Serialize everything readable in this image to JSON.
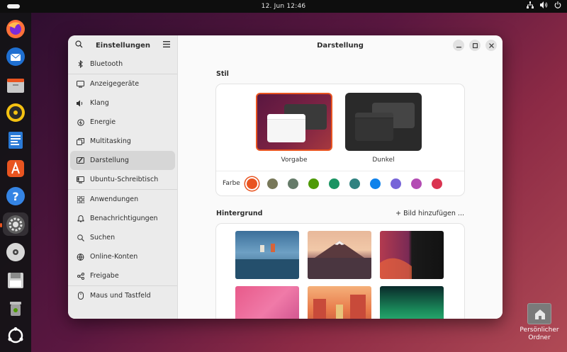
{
  "topbar": {
    "clock": "12. Jun  12:46"
  },
  "dock": {
    "items": [
      {
        "name": "firefox",
        "active": false
      },
      {
        "name": "thunderbird",
        "active": false
      },
      {
        "name": "files",
        "active": false
      },
      {
        "name": "rhythmbox",
        "active": false
      },
      {
        "name": "writer",
        "active": false
      },
      {
        "name": "app-center",
        "active": false
      },
      {
        "name": "help",
        "active": false
      },
      {
        "name": "settings",
        "active": true
      },
      {
        "name": "disc",
        "active": false
      },
      {
        "name": "save",
        "active": false
      },
      {
        "name": "trash",
        "active": false
      },
      {
        "name": "ubuntu-apps",
        "active": false
      }
    ]
  },
  "settings": {
    "title": "Einstellungen",
    "sidebar": {
      "items": [
        {
          "id": "bluetooth",
          "label": "Bluetooth",
          "icon": "bluetooth-icon"
        },
        {
          "id": "displays",
          "label": "Anzeigegeräte",
          "icon": "display-icon"
        },
        {
          "id": "sound",
          "label": "Klang",
          "icon": "speaker-icon"
        },
        {
          "id": "power",
          "label": "Energie",
          "icon": "power-icon"
        },
        {
          "id": "multitasking",
          "label": "Multitasking",
          "icon": "multitasking-icon"
        },
        {
          "id": "appearance",
          "label": "Darstellung",
          "icon": "appearance-icon",
          "selected": true
        },
        {
          "id": "ubuntu-desktop",
          "label": "Ubuntu-Schreibtisch",
          "icon": "desktop-icon"
        },
        {
          "id": "apps",
          "label": "Anwendungen",
          "icon": "apps-grid-icon"
        },
        {
          "id": "notifications",
          "label": "Benachrichtigungen",
          "icon": "bell-icon"
        },
        {
          "id": "search",
          "label": "Suchen",
          "icon": "search-icon"
        },
        {
          "id": "online-accounts",
          "label": "Online-Konten",
          "icon": "cloud-icon"
        },
        {
          "id": "sharing",
          "label": "Freigabe",
          "icon": "share-icon"
        },
        {
          "id": "mouse",
          "label": "Maus und Tastfeld",
          "icon": "mouse-icon"
        }
      ]
    },
    "main": {
      "title": "Darstellung",
      "style": {
        "heading": "Stil",
        "light_label": "Vorgabe",
        "dark_label": "Dunkel",
        "color_label": "Farbe",
        "colors": [
          "#e95420",
          "#787859",
          "#657b69",
          "#4e9a06",
          "#1a9463",
          "#308280",
          "#0e82eb",
          "#7764d8",
          "#b34cb3",
          "#da3450"
        ],
        "selected_color": 0
      },
      "background": {
        "heading": "Hintergrund",
        "add_label": "+ Bild hinzufügen ..."
      }
    }
  },
  "desktop": {
    "home_folder_label_1": "Persönlicher",
    "home_folder_label_2": "Ordner"
  }
}
